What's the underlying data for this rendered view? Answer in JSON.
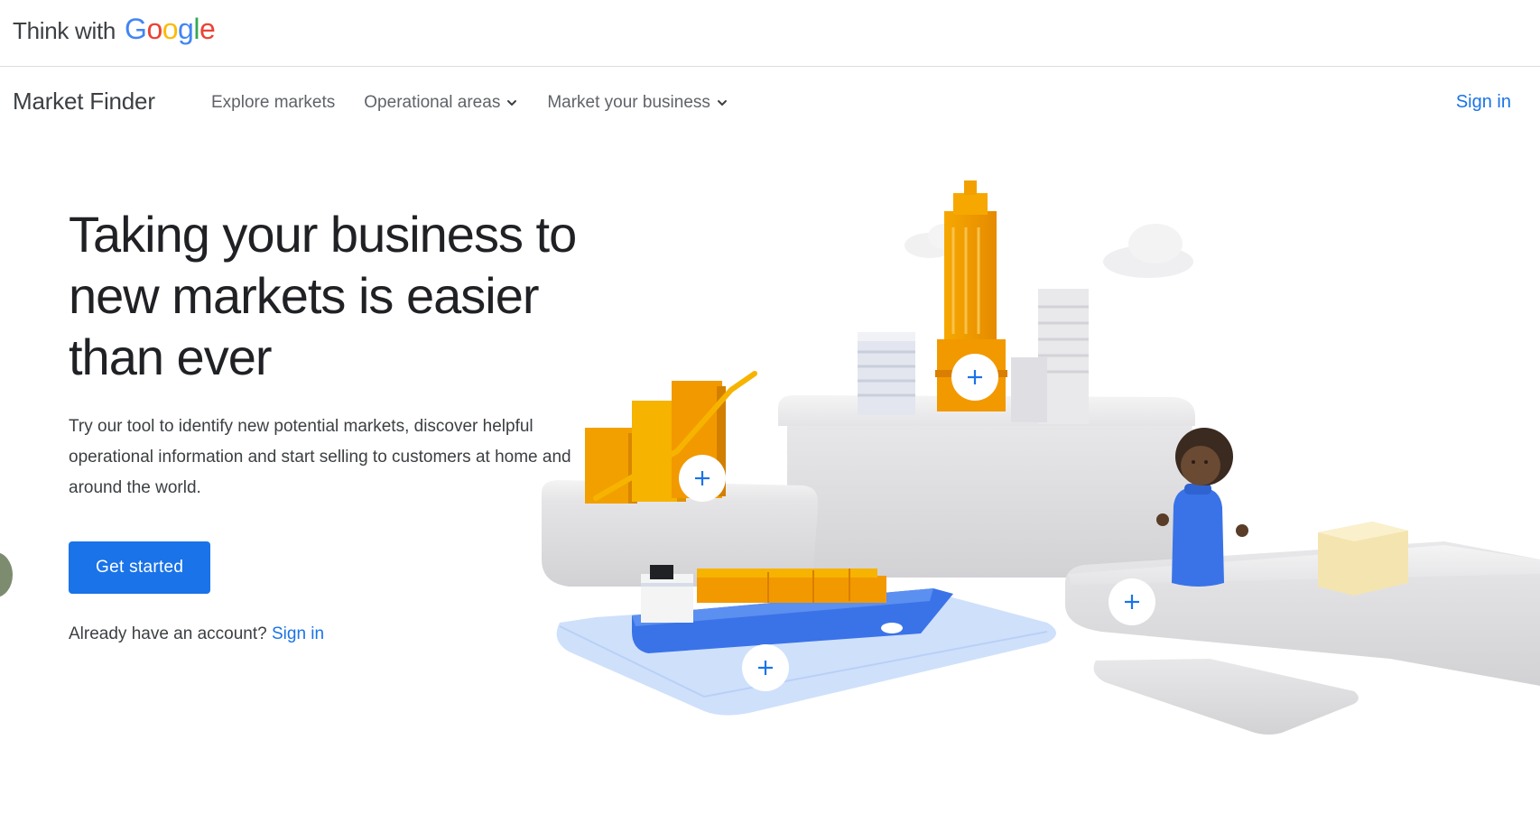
{
  "header": {
    "brand_prefix": "Think with",
    "brand_google": [
      "G",
      "o",
      "o",
      "g",
      "l",
      "e"
    ]
  },
  "nav": {
    "product_name": "Market Finder",
    "items": [
      {
        "label": "Explore markets",
        "has_dropdown": false
      },
      {
        "label": "Operational areas",
        "has_dropdown": true
      },
      {
        "label": "Market your business",
        "has_dropdown": true
      }
    ],
    "sign_in": "Sign in"
  },
  "hero": {
    "title": "Taking your business to new markets is easier than ever",
    "description": "Try our tool to identify new potential markets, discover helpful operational information and start selling to customers at home and around the world.",
    "cta_label": "Get started",
    "account_prompt": "Already have an account?",
    "account_link": "Sign in"
  },
  "colors": {
    "accent_blue": "#1a73e8",
    "google_blue": "#4285f4",
    "google_red": "#ea4335",
    "google_yellow": "#fbbc05",
    "google_green": "#34a853",
    "illustration_orange": "#f29900"
  },
  "icons": {
    "dropdown": "chevron-down-icon",
    "hotspot": "plus-icon"
  }
}
